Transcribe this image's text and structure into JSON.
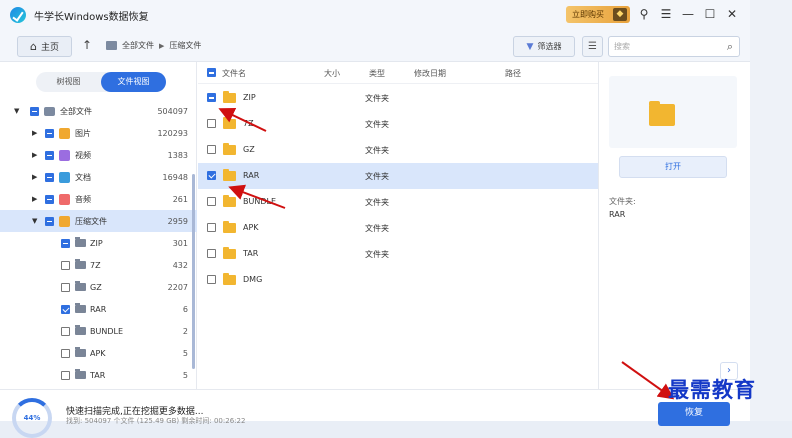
{
  "app": {
    "title": "牛学长Windows数据恢复"
  },
  "titlebar": {
    "buy_label": "立即购买"
  },
  "nav": {
    "home_label": "主页",
    "breadcrumb": [
      "全部文件",
      "压缩文件"
    ],
    "filter_label": "筛选器",
    "search_placeholder": "搜索"
  },
  "sidebar": {
    "tabs": [
      {
        "label": "树视图",
        "active": false
      },
      {
        "label": "文件视图",
        "active": true
      }
    ],
    "tree": [
      {
        "label": "全部文件",
        "count": "504097"
      },
      {
        "label": "图片",
        "count": "120293"
      },
      {
        "label": "视频",
        "count": "1383"
      },
      {
        "label": "文档",
        "count": "16948"
      },
      {
        "label": "音频",
        "count": "261"
      },
      {
        "label": "压缩文件",
        "count": "2959"
      },
      {
        "label": "ZIP",
        "count": "301"
      },
      {
        "label": "7Z",
        "count": "432"
      },
      {
        "label": "GZ",
        "count": "2207"
      },
      {
        "label": "RAR",
        "count": "6"
      },
      {
        "label": "BUNDLE",
        "count": "2"
      },
      {
        "label": "APK",
        "count": "5"
      },
      {
        "label": "TAR",
        "count": "5"
      }
    ]
  },
  "table": {
    "headers": {
      "name": "文件名",
      "size": "大小",
      "type": "类型",
      "modified": "修改日期",
      "path": "路径"
    },
    "rows": [
      {
        "name": "ZIP",
        "type": "文件夹"
      },
      {
        "name": "7Z",
        "type": "文件夹"
      },
      {
        "name": "GZ",
        "type": "文件夹"
      },
      {
        "name": "RAR",
        "type": "文件夹"
      },
      {
        "name": "BUNDLE",
        "type": "文件夹"
      },
      {
        "name": "APK",
        "type": "文件夹"
      },
      {
        "name": "TAR",
        "type": "文件夹"
      },
      {
        "name": "DMG",
        "type": "文件夹"
      }
    ]
  },
  "preview": {
    "open_label": "打开",
    "folder_label": "文件夹:",
    "folder_value": "RAR"
  },
  "footer": {
    "progress": "44%",
    "status": "快速扫描完成,正在挖掘更多数据...",
    "detail": "找到: 504097 个文件 (125.49 GB) 剩余时间: 00:26:22",
    "restore_label": "恢复"
  },
  "watermark": "最需教育",
  "colors": {
    "accent": "#2f6fe0",
    "folder": "#f2b630",
    "annotation": "#d01010",
    "watermark": "#1438c7"
  }
}
